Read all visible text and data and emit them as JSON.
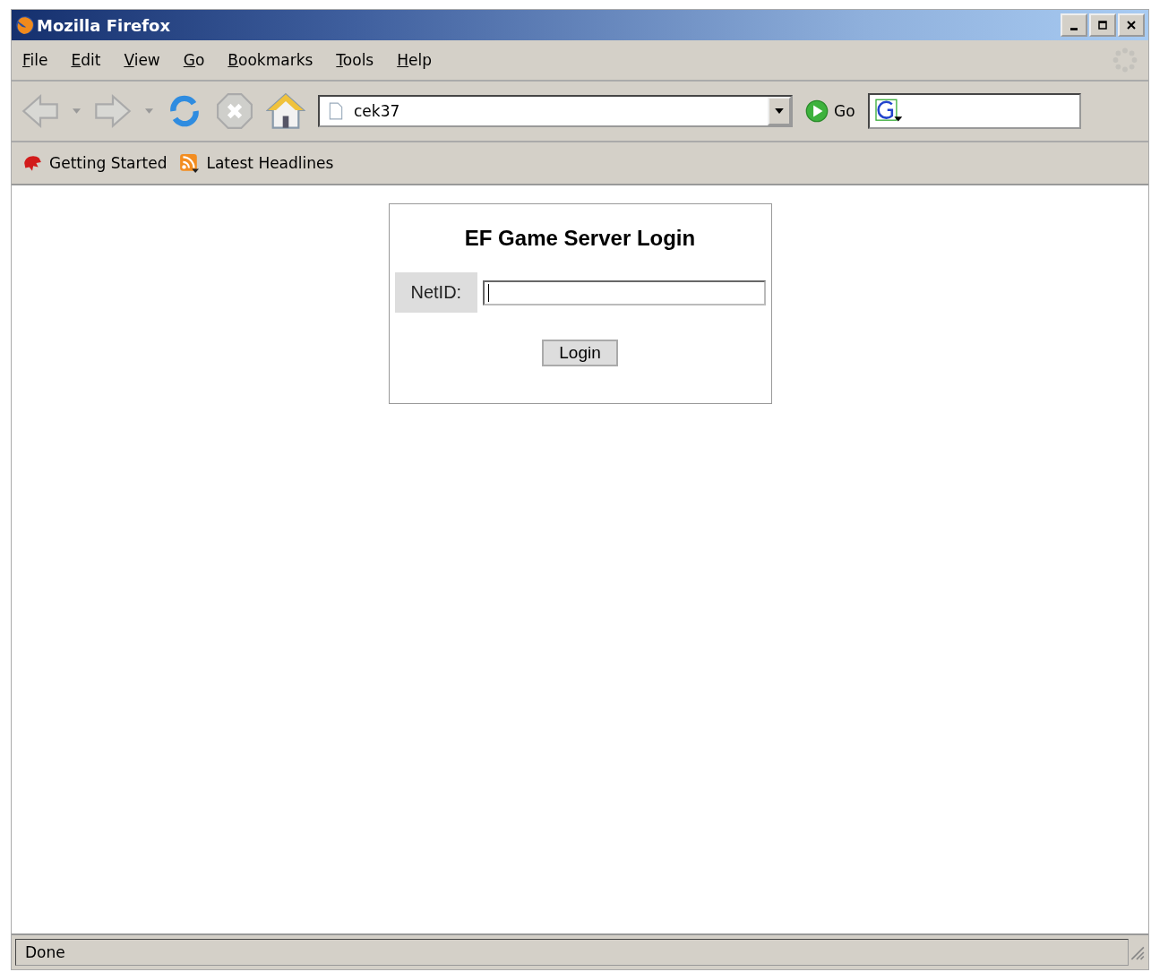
{
  "window": {
    "title": "Mozilla Firefox"
  },
  "menu": [
    "File",
    "Edit",
    "View",
    "Go",
    "Bookmarks",
    "Tools",
    "Help"
  ],
  "address_bar": {
    "value": "cek37"
  },
  "go_button": "Go",
  "bookmarks": [
    "Getting Started",
    "Latest Headlines"
  ],
  "page": {
    "heading": "EF Game Server Login",
    "field_label": "NetID:",
    "button": "Login"
  },
  "status_bar": "Done"
}
